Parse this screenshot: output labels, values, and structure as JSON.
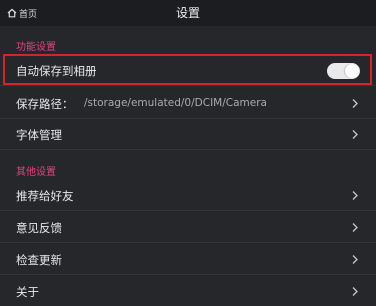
{
  "topbar": {
    "back_label": "首页",
    "title": "设置"
  },
  "sections": [
    {
      "header": "功能设置",
      "items": [
        {
          "label": "自动保存到相册",
          "control": "toggle",
          "toggle_on": false
        },
        {
          "label": "保存路径：",
          "value": "/storage/emulated/0/DCIM/Camera",
          "control": "chevron-right-icon"
        },
        {
          "label": "字体管理",
          "control": "chevron-right-icon"
        }
      ]
    },
    {
      "header": "其他设置",
      "items": [
        {
          "label": "推荐给好友",
          "control": "chevron-right-icon"
        },
        {
          "label": "意见反馈",
          "control": "chevron-right-icon"
        },
        {
          "label": "检查更新",
          "control": "chevron-right-icon"
        },
        {
          "label": "关于",
          "control": "chevron-right-icon"
        }
      ]
    }
  ],
  "colors": {
    "background": "#26272b",
    "topbar": "#1c1d20",
    "section_header": "#e0457b",
    "highlight_border": "#d3242c",
    "text": "#e8e8e8",
    "secondary_text": "#a9a9ae"
  }
}
